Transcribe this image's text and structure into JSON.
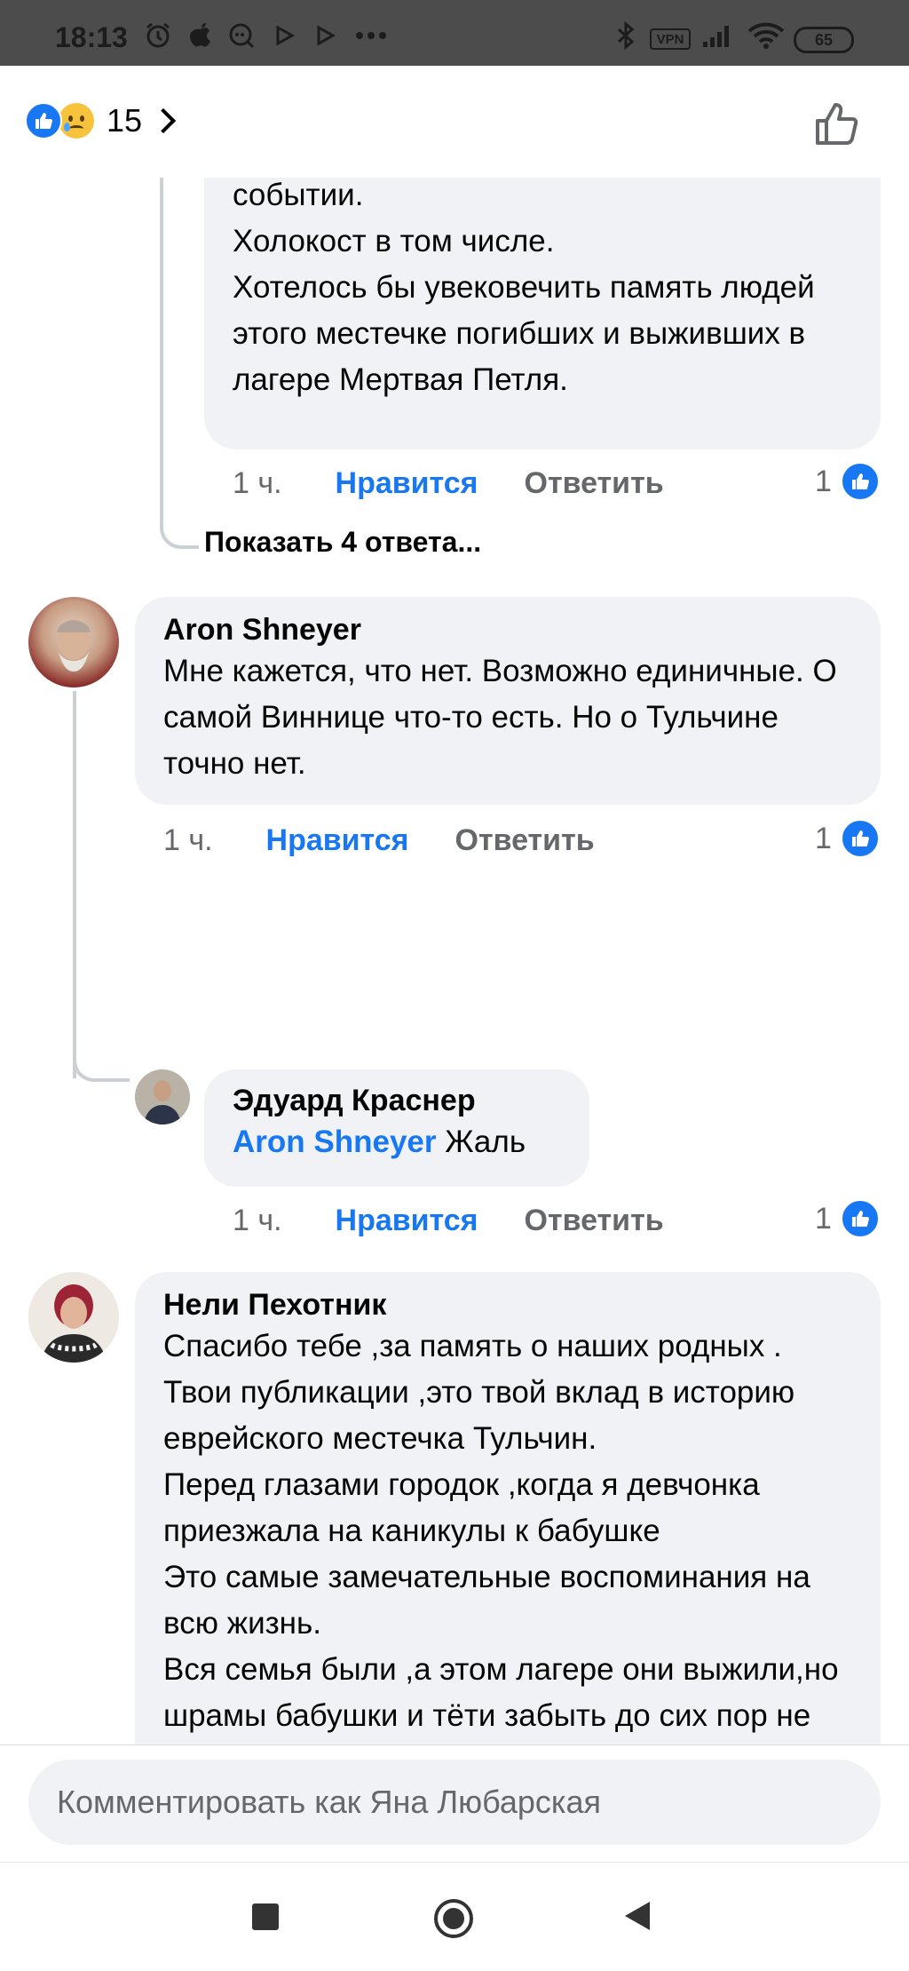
{
  "status_bar": {
    "time": "18:13",
    "icons": [
      "alarm-icon",
      "apple-icon",
      "chat-bubble-icon",
      "play-icon",
      "play-outline-icon",
      "more-dots-icon",
      "bluetooth-icon",
      "signal-icon",
      "wifi-icon"
    ],
    "vpn_label": "VPN",
    "battery": "65"
  },
  "header": {
    "reaction_count": "15",
    "reactions": [
      "like-icon",
      "sad-icon"
    ]
  },
  "comments": [
    {
      "text": "событии.\nХолокост в том числе.\nХотелось бы увековечить память людей этого местечке погибших и выживших в лагере  Мертвая Петля.",
      "time": "1 ч.",
      "like_label": "Нравится",
      "reply_label": "Ответить",
      "like_count": "1"
    },
    {
      "author": "Aron Shneyer",
      "text": "Мне кажется,  что нет. Возможно единичные.  О самой Виннице что-то есть.  Но о Тульчине точно нет.",
      "time": "1 ч.",
      "like_label": "Нравится",
      "reply_label": "Ответить",
      "like_count": "1"
    },
    {
      "author": "Эдуард Краснер",
      "mention": "Aron Shneyer",
      "text": " Жаль",
      "time": "1 ч.",
      "like_label": "Нравится",
      "reply_label": "Ответить",
      "like_count": "1"
    },
    {
      "author": "Нели Пехотник",
      "text": "Спасибо тебе  ,за память о наших родных .\nТвои публикации  ,это твой вклад в историю еврейского местечка Тульчин.\n Перед глазами городок ,когда я девчонка приезжала  на каникулы к бабушке\nЭто самые замечательные воспоминания на всю жизнь.\nВся семья  были ,а этом лагере  они выжили,но шрамы бабушки  и тёти забыть до сих пор не могу."
    }
  ],
  "show_replies": "Показать 4 ответа...",
  "composer": {
    "placeholder": "Комментировать как Яна Любарская"
  },
  "navbar": {
    "buttons": [
      "recents-square-icon",
      "home-circle-icon",
      "back-triangle-icon"
    ]
  },
  "colors": {
    "accent": "#1877f2",
    "bubble": "#f0f2f5",
    "muted": "#65676b",
    "status_bar": "#4c4c4c"
  }
}
